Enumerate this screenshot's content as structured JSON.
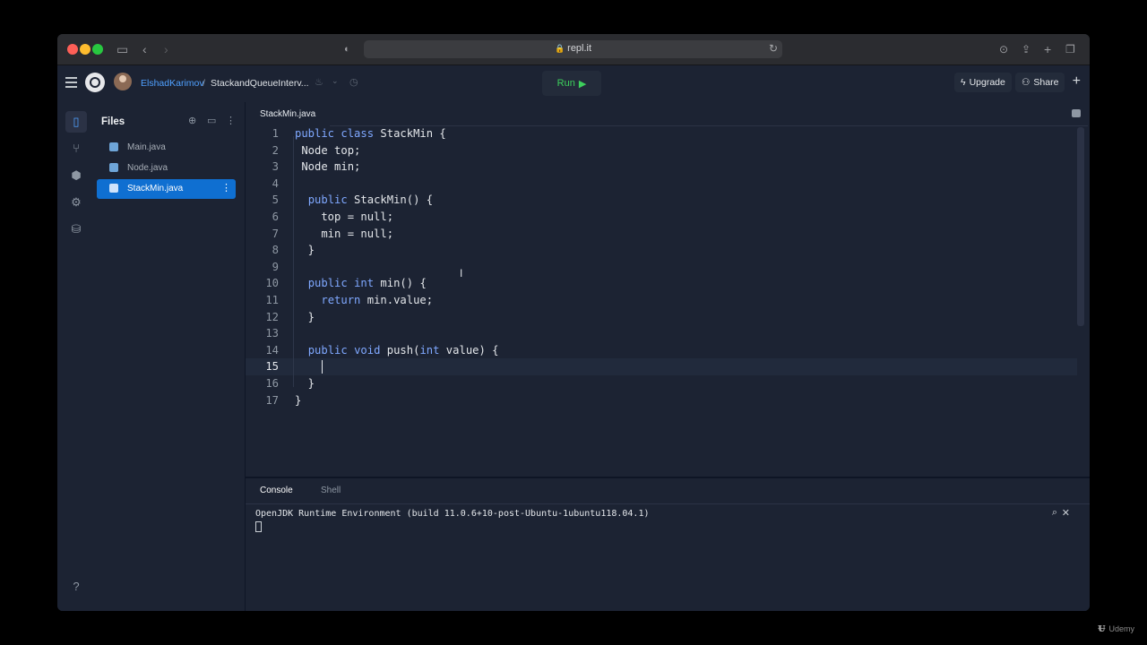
{
  "browser": {
    "url": "repl.it"
  },
  "header": {
    "username": "ElshadKarimov",
    "separator": "/",
    "repl_name": "StackandQueueInterv...",
    "run_label": "Run",
    "upgrade_label": "Upgrade",
    "share_label": "Share"
  },
  "files_panel": {
    "title": "Files",
    "files": [
      {
        "name": "Main.java",
        "active": false
      },
      {
        "name": "Node.java",
        "active": false
      },
      {
        "name": "StackMin.java",
        "active": true
      }
    ]
  },
  "editor": {
    "tab_label": "StackMin.java",
    "current_line": 15,
    "lines": [
      {
        "n": "1",
        "code": "public class StackMin {"
      },
      {
        "n": "2",
        "code": " Node top;"
      },
      {
        "n": "3",
        "code": " Node min;"
      },
      {
        "n": "4",
        "code": ""
      },
      {
        "n": "5",
        "code": "  public StackMin() {"
      },
      {
        "n": "6",
        "code": "    top = null;"
      },
      {
        "n": "7",
        "code": "    min = null;"
      },
      {
        "n": "8",
        "code": "  }"
      },
      {
        "n": "9",
        "code": ""
      },
      {
        "n": "10",
        "code": "  public int min() {"
      },
      {
        "n": "11",
        "code": "    return min.value;"
      },
      {
        "n": "12",
        "code": "  }"
      },
      {
        "n": "13",
        "code": ""
      },
      {
        "n": "14",
        "code": "  public void push(int value) {"
      },
      {
        "n": "15",
        "code": "    "
      },
      {
        "n": "16",
        "code": "  }"
      },
      {
        "n": "17",
        "code": "}"
      }
    ]
  },
  "console": {
    "tabs": [
      "Console",
      "Shell"
    ],
    "output": "OpenJDK Runtime Environment (build 11.0.6+10-post-Ubuntu-1ubuntu118.04.1)"
  },
  "watermark": "Udemy",
  "colors": {
    "background": "#1c2333",
    "accent": "#0f6fd1",
    "run_green": "#3dcf5c",
    "keyword": "#7fa8ff",
    "link": "#4fa0ff"
  }
}
